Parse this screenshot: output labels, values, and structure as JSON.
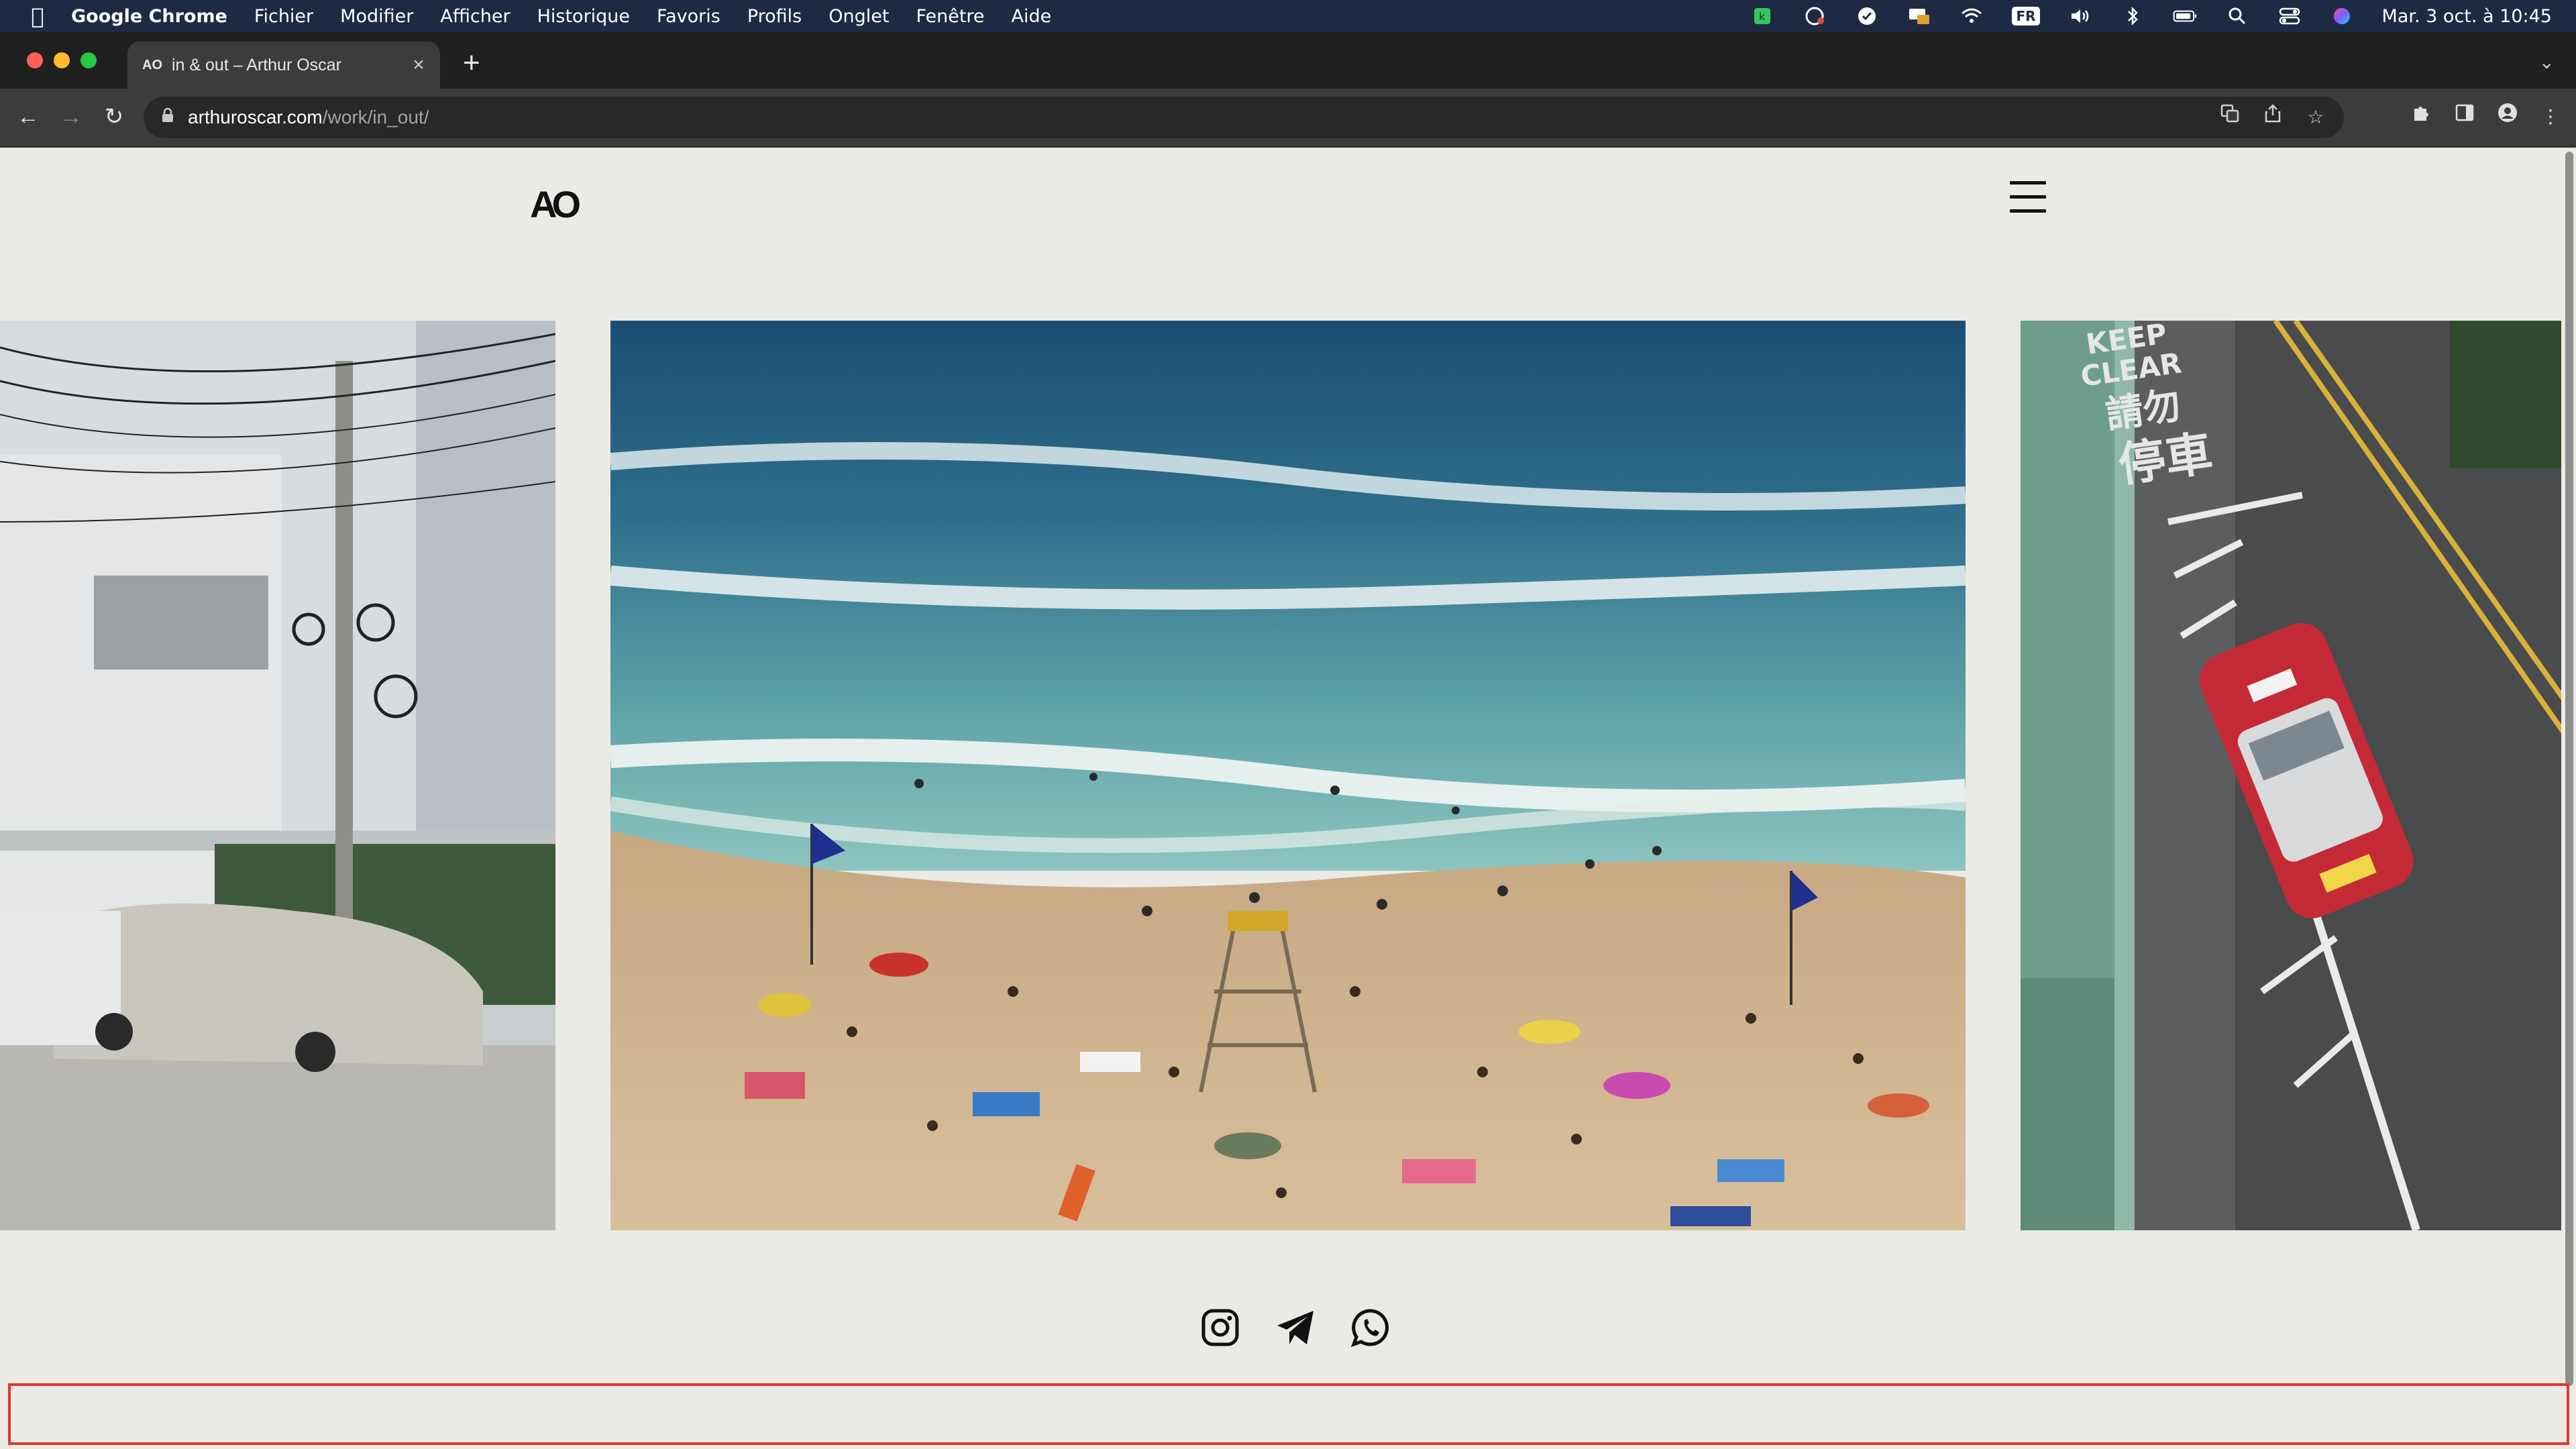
{
  "menubar": {
    "app_name": "Google Chrome",
    "items": [
      "Fichier",
      "Modifier",
      "Afficher",
      "Historique",
      "Favoris",
      "Profils",
      "Onglet",
      "Fenêtre",
      "Aide"
    ],
    "input_badge": "FR",
    "clock": "Mar. 3 oct. à 10:45"
  },
  "browser": {
    "tab_favicon": "AO",
    "tab_title": "in & out – Arthur Oscar",
    "url_host": "arthuroscar.com",
    "url_path": "/work/in_out/"
  },
  "site": {
    "logo": "AO",
    "photo_text": {
      "keep": "KEEP",
      "clear": "CLEAR",
      "zh1": "請勿",
      "zh2": "停車"
    }
  },
  "icons": {
    "apple": "apple-icon",
    "back": "arrow-left-icon",
    "forward": "arrow-right-icon",
    "reload": "reload-icon",
    "lock": "lock-icon",
    "menu": "hamburger-icon",
    "instagram": "instagram-icon",
    "telegram": "telegram-icon",
    "whatsapp": "whatsapp-icon"
  },
  "colors": {
    "menubar_bg": "#1e2a44",
    "page_bg": "#ebeae6",
    "frame_red": "#e03a2a"
  }
}
